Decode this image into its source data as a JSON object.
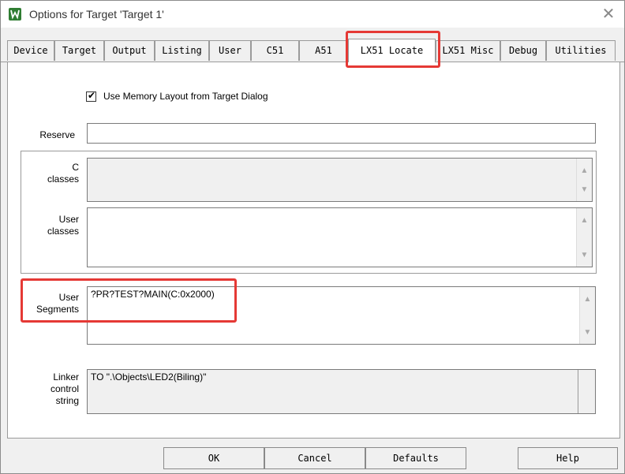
{
  "window": {
    "title": "Options for Target 'Target 1'"
  },
  "tabs": [
    {
      "label": "Device"
    },
    {
      "label": "Target"
    },
    {
      "label": "Output"
    },
    {
      "label": "Listing"
    },
    {
      "label": "User"
    },
    {
      "label": "C51"
    },
    {
      "label": "A51"
    },
    {
      "label": "LX51 Locate",
      "active": true
    },
    {
      "label": "LX51 Misc"
    },
    {
      "label": "Debug"
    },
    {
      "label": "Utilities"
    }
  ],
  "memory_layout": {
    "label": "Use Memory Layout from Target Dialog",
    "checked": true,
    "check_glyph": "✔"
  },
  "fields": {
    "reserve": {
      "label": "Reserve",
      "value": ""
    },
    "c_classes": {
      "label_line1": "C",
      "label_line2": "classes",
      "value": ""
    },
    "user_classes": {
      "label_line1": "User",
      "label_line2": "classes",
      "value": ""
    },
    "user_segments": {
      "label_line1": "User",
      "label_line2": "Segments",
      "value": "?PR?TEST?MAIN(C:0x2000)"
    },
    "linker_control": {
      "label_line1": "Linker",
      "label_line2": "control",
      "label_line3": "string",
      "value": "TO \".\\Objects\\LED2(Biling)\""
    }
  },
  "buttons": {
    "ok": "OK",
    "cancel": "Cancel",
    "defaults": "Defaults",
    "help": "Help"
  },
  "icons": {
    "app": "keil-app-icon",
    "close": "close-icon",
    "scroll_up": "scroll-up-arrow-icon",
    "scroll_down": "scroll-down-arrow-icon"
  },
  "glyphs": {
    "close": "✕",
    "up": "▲",
    "down": "▼"
  },
  "colors": {
    "highlight": "#e53935",
    "app_icon": "#2f7d32"
  }
}
